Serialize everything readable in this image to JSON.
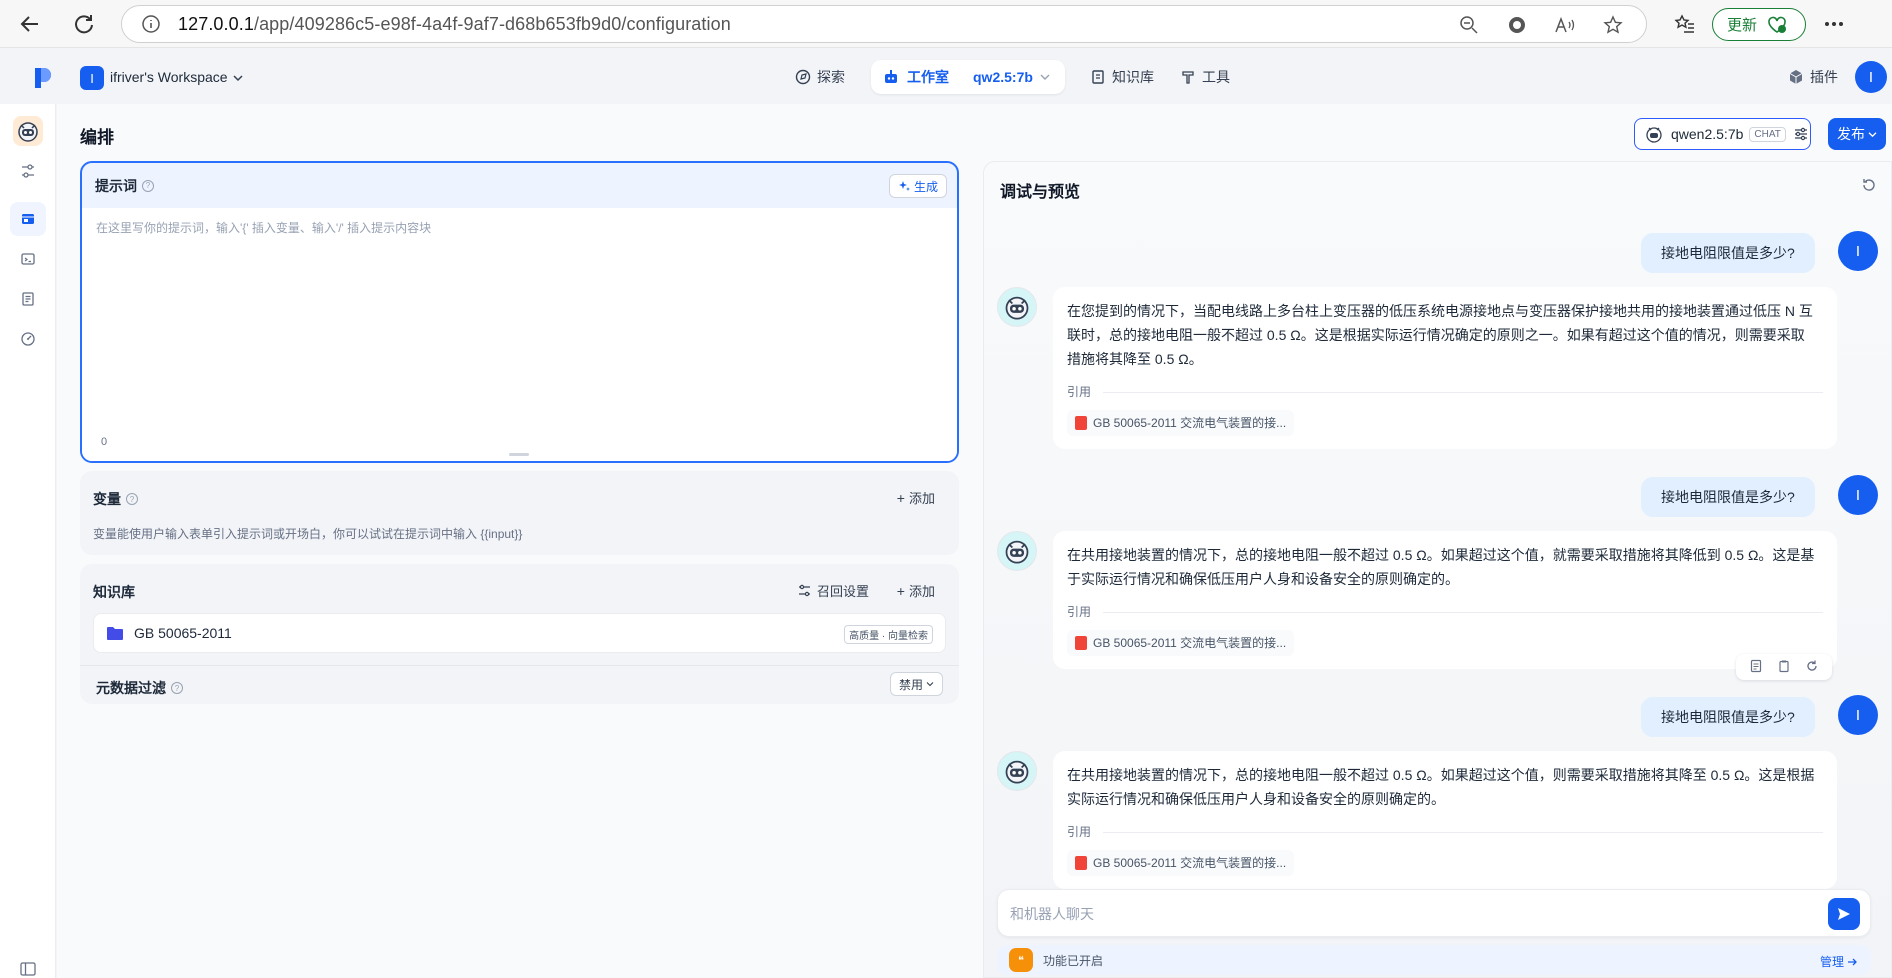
{
  "browser": {
    "url_host": "127.0.0.1",
    "url_path": "/app/409286c5-e98f-4a4f-9af7-d68b653fb9d0/configuration",
    "update_label": "更新"
  },
  "header": {
    "workspace_initial": "I",
    "workspace_name": "ifriver's Workspace",
    "nav": {
      "explore": "探索",
      "studio": "工作室",
      "app_name": "qw2.5:7b",
      "knowledge": "知识库",
      "tools": "工具",
      "plugins": "插件"
    },
    "user_initial": "I"
  },
  "page": {
    "title": "编排",
    "model_name": "qwen2.5:7b",
    "model_tag": "CHAT",
    "publish_label": "发布"
  },
  "prompt": {
    "title": "提示词",
    "generate_label": "生成",
    "placeholder": "在这里写你的提示词，输入'{' 插入变量、输入'/' 插入提示内容块",
    "char_count": "0"
  },
  "variables": {
    "title": "变量",
    "add_label": "添加",
    "description": "变量能使用户输入表单引入提示词或开场白，你可以试试在提示词中输入 {{input}}"
  },
  "knowledge": {
    "title": "知识库",
    "recall_label": "召回设置",
    "add_label": "添加",
    "item_name": "GB 50065-2011",
    "item_tag": "高质量 · 向量检索",
    "metadata_title": "元数据过滤",
    "metadata_value": "禁用"
  },
  "debug": {
    "title": "调试与预览",
    "cite_label": "引用",
    "cite_doc": "GB 50065-2011 交流电气装置的接...",
    "messages": [
      {
        "question": "接地电阻限值是多少?",
        "answer": "在您提到的情况下，当配电线路上多台柱上变压器的低压系统电源接地点与变压器保护接地共用的接地装置通过低压 N 互联时，总的接地电阻一般不超过 0.5 Ω。这是根据实际运行情况确定的原则之一。如果有超过这个值的情况，则需要采取措施将其降至 0.5 Ω。"
      },
      {
        "question": "接地电阻限值是多少?",
        "answer": "在共用接地装置的情况下，总的接地电阻一般不超过 0.5 Ω。如果超过这个值，就需要采取措施将其降低到 0.5 Ω。这是基于实际运行情况和确保低压用户人身和设备安全的原则确定的。"
      },
      {
        "question": "接地电阻限值是多少?",
        "answer": "在共用接地装置的情况下，总的接地电阻一般不超过 0.5 Ω。如果超过这个值，则需要采取措施将其降至 0.5 Ω。这是根据实际运行情况和确保低压用户人身和设备安全的原则确定的。"
      }
    ],
    "input_placeholder": "和机器人聊天",
    "feature_text": "功能已开启",
    "manage_label": "管理"
  },
  "colors": {
    "primary": "#155eef",
    "question_bg": "#e1effe",
    "update_green": "#1a7f37"
  }
}
